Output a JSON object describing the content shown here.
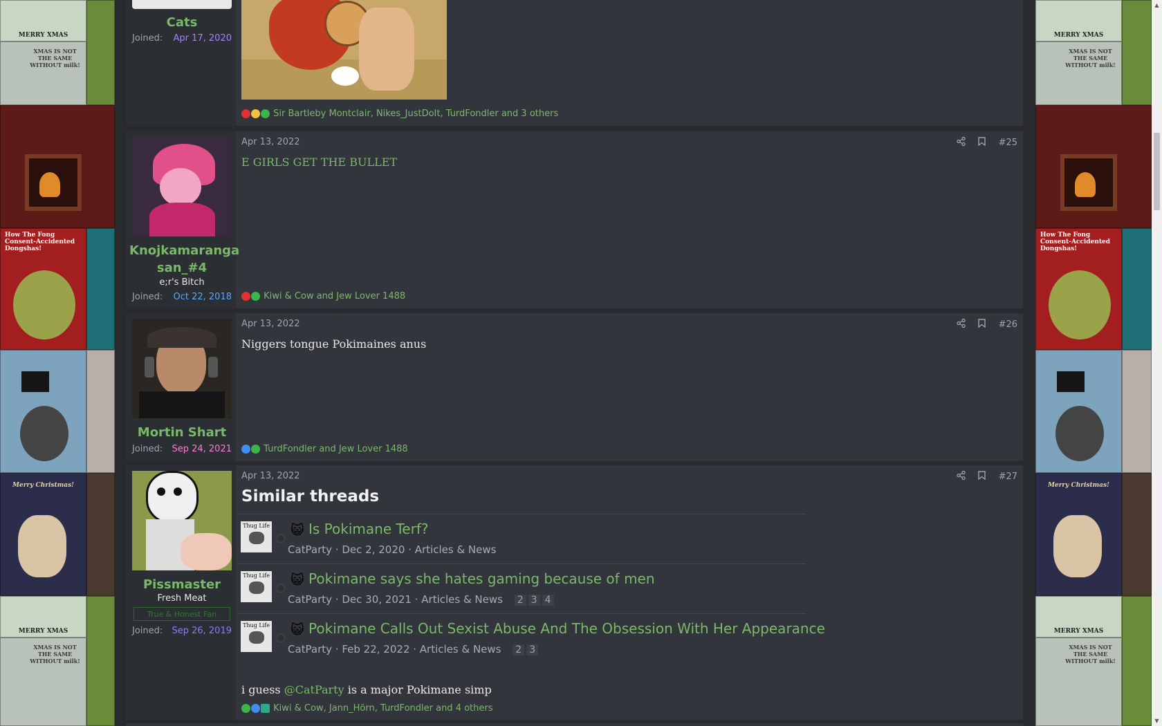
{
  "page": {
    "background": "#282a2e",
    "accent": "#7ab96a"
  },
  "colors": {
    "date_purple": "#a780ff",
    "date_blue": "#5aa8ff",
    "date_pink": "#ff7bd8",
    "date_violet": "#8a7cff"
  },
  "background_tiles": {
    "merry_xmas": "MERRY XMAS",
    "milk": "XMAS IS NOT THE SAME WITHOUT milk!",
    "grinch": "How The Fong Consent-Accidented Dongshas!",
    "merry_christmas": "Merry Christmas!"
  },
  "posts": [
    {
      "username": "Cats",
      "joined_label": "Joined:",
      "joined": "Apr 17, 2020",
      "reactions": "Sir Bartleby Montclair, Nikes_JustDoIt, TurdFondler and 3 others"
    },
    {
      "date": "Apr 13, 2022",
      "number": "#25",
      "username": "Knojkamaranga san_#4",
      "user_title": "e;r's Bitch",
      "joined_label": "Joined:",
      "joined": "Oct 22, 2018",
      "body": "E GIRLS GET THE BULLET",
      "reactions": "Kiwi & Cow and Jew Lover 1488"
    },
    {
      "date": "Apr 13, 2022",
      "number": "#26",
      "username": "Mortin Shart",
      "joined_label": "Joined:",
      "joined": "Sep 24, 2021",
      "body": "Niggers tongue Pokimaines anus",
      "reactions": "TurdFondler and Jew Lover 1488"
    },
    {
      "date": "Apr 13, 2022",
      "number": "#27",
      "username": "Pissmaster",
      "user_title": "Fresh Meat",
      "user_banner": "True & Honest Fan",
      "joined_label": "Joined:",
      "joined": "Sep 26, 2019",
      "body_prefix": "i guess",
      "mention": "@CatParty",
      "body_suffix": "is a major Pokimane simp",
      "reactions": "Kiwi & Cow, Jann_Hörn, TurdFondler and 4 others"
    }
  ],
  "similar_threads": {
    "title": "Similar threads",
    "thumb_text": "Thug Life",
    "items": [
      {
        "title": "Is Pokimane Terf?",
        "author": "CatParty",
        "date": "Dec 2, 2020",
        "forum": "Articles & News",
        "pages": []
      },
      {
        "title": "Pokimane says she hates gaming because of men",
        "author": "CatParty",
        "date": "Dec 30, 2021",
        "forum": "Articles & News",
        "pages": [
          "2",
          "3",
          "4"
        ]
      },
      {
        "title": "Pokimane Calls Out Sexist Abuse And The Obsession With Her Appearance",
        "author": "CatParty",
        "date": "Feb 22, 2022",
        "forum": "Articles & News",
        "pages": [
          "2",
          "3"
        ]
      }
    ]
  },
  "icons": {
    "share": "share-icon",
    "bookmark": "bookmark-icon",
    "category": "cat-face-icon"
  }
}
